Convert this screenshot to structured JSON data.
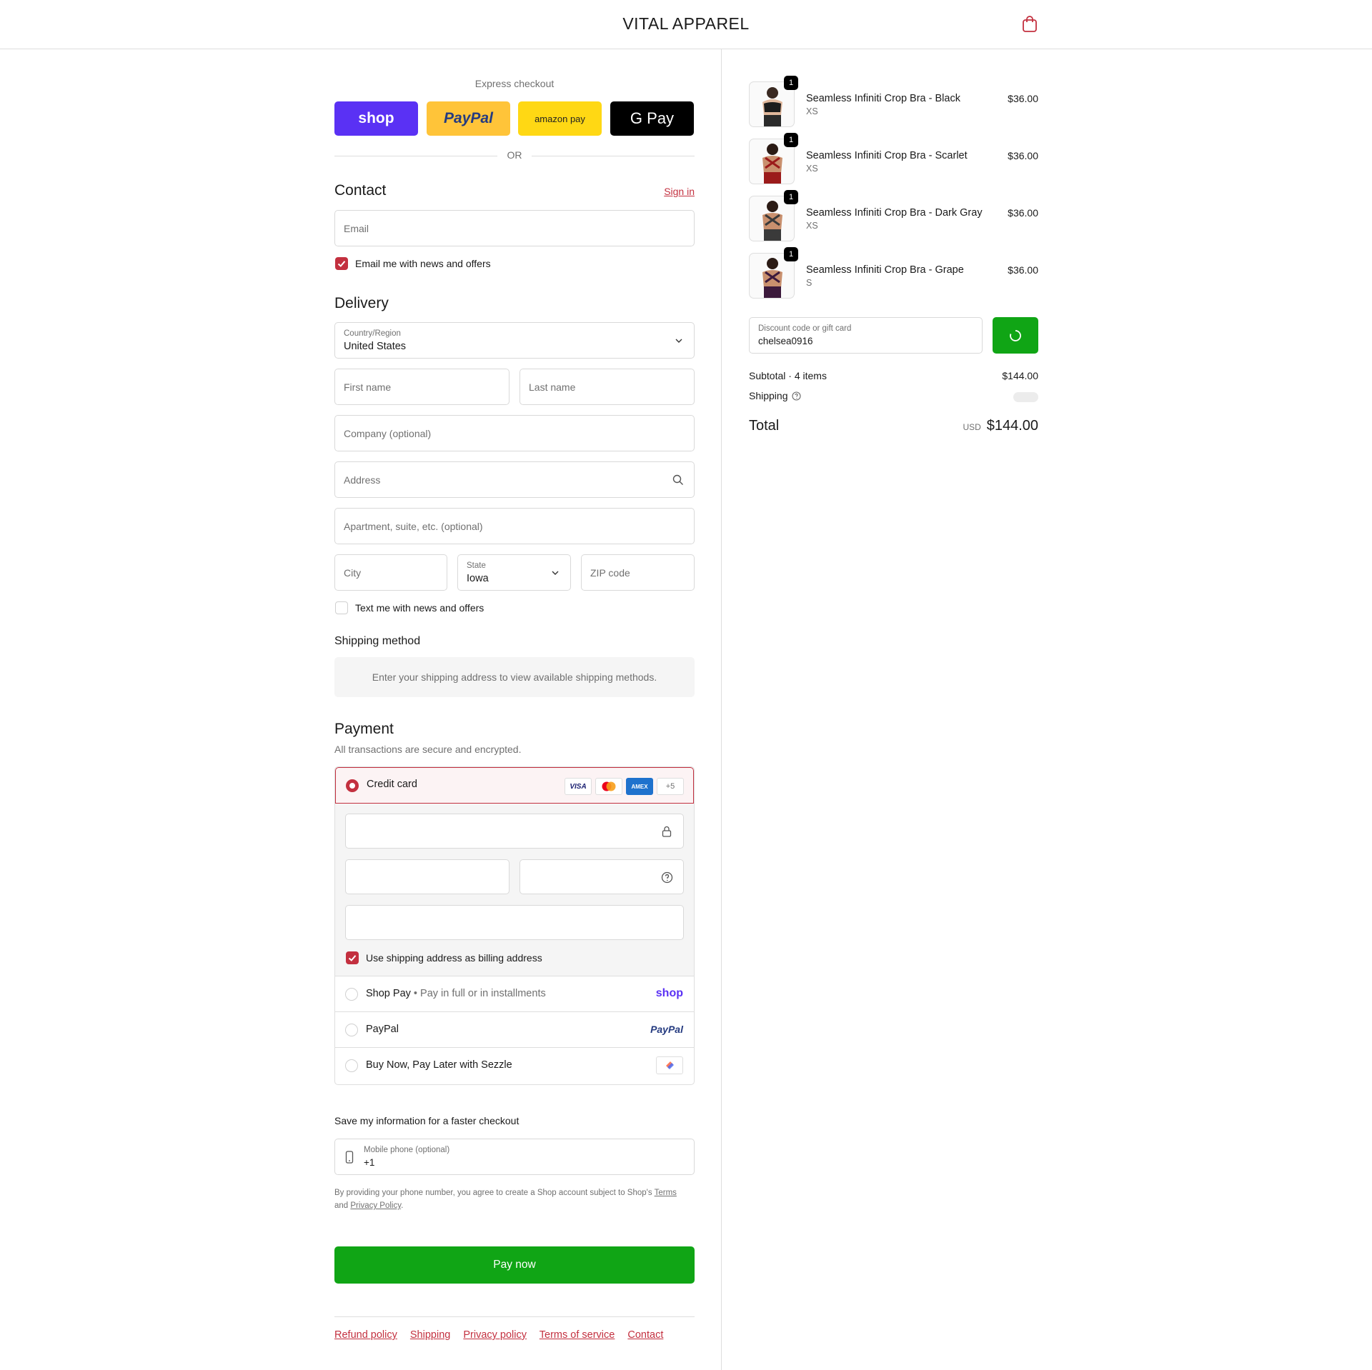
{
  "header": {
    "brand": "VITAL APPAREL",
    "cart_icon": "shopping-bag-icon"
  },
  "express": {
    "title": "Express checkout",
    "buttons": [
      {
        "name": "shop",
        "label": "shop",
        "color": "#5a31f4"
      },
      {
        "name": "paypal",
        "label": "PayPal",
        "color": "#ffc439"
      },
      {
        "name": "amazon",
        "label": "amazon pay",
        "color": "#ffd814"
      },
      {
        "name": "gpay",
        "label": "G Pay",
        "color": "#000000"
      }
    ],
    "or": "OR"
  },
  "contact": {
    "heading": "Contact",
    "sign_in": "Sign in",
    "email_placeholder": "Email",
    "news_label": "Email me with news and offers",
    "news_checked": true
  },
  "delivery": {
    "heading": "Delivery",
    "country_label": "Country/Region",
    "country_value": "United States",
    "first_name": "First name",
    "last_name": "Last name",
    "company": "Company (optional)",
    "address": "Address",
    "apartment": "Apartment, suite, etc. (optional)",
    "city": "City",
    "state_label": "State",
    "state_value": "Iowa",
    "zip": "ZIP code",
    "text_label": "Text me with news and offers",
    "text_checked": false
  },
  "shipping": {
    "heading": "Shipping method",
    "info": "Enter your shipping address to view available shipping methods."
  },
  "payment": {
    "heading": "Payment",
    "subtitle": "All transactions are secure and encrypted.",
    "credit_card_label": "Credit card",
    "card_badges": [
      "VISA",
      "MC",
      "AMEX",
      "+5"
    ],
    "billing_label": "Use shipping address as billing address",
    "billing_checked": true,
    "shop_pay_label": "Shop Pay",
    "shop_pay_sub": "Pay in full or in installments",
    "shop_pay_logo": "shop",
    "paypal_label": "PayPal",
    "paypal_logo": "PayPal",
    "sezzle_label": "Buy Now, Pay Later with Sezzle"
  },
  "save": {
    "heading": "Save my information for a faster checkout",
    "phone_label": "Mobile phone (optional)",
    "phone_value": "+1",
    "disclaimer_1": "By providing your phone number, you agree to create a Shop account subject to Shop's",
    "terms": "Terms",
    "disclaimer_2": "and",
    "privacy": "Privacy Policy",
    "disclaimer_end": "."
  },
  "pay_now": "Pay now",
  "footer": {
    "links": [
      "Refund policy",
      "Shipping",
      "Privacy policy",
      "Terms of service",
      "Contact"
    ]
  },
  "summary": {
    "items": [
      {
        "qty": "1",
        "name": "Seamless Infiniti Crop Bra - Black",
        "variant": "XS",
        "price": "$36.00",
        "color": "#1c1c1c"
      },
      {
        "qty": "1",
        "name": "Seamless Infiniti Crop Bra - Scarlet",
        "variant": "XS",
        "price": "$36.00",
        "color": "#9b1b1b"
      },
      {
        "qty": "1",
        "name": "Seamless Infiniti Crop Bra - Dark Gray",
        "variant": "XS",
        "price": "$36.00",
        "color": "#3a3a3a"
      },
      {
        "qty": "1",
        "name": "Seamless Infiniti Crop Bra - Grape",
        "variant": "S",
        "price": "$36.00",
        "color": "#3c1a3c"
      }
    ],
    "discount_label": "Discount code or gift card",
    "discount_value": "chelsea0916",
    "subtotal_label": "Subtotal · 4 items",
    "subtotal_value": "$144.00",
    "shipping_label": "Shipping",
    "total_label": "Total",
    "total_currency": "USD",
    "total_value": "$144.00"
  }
}
